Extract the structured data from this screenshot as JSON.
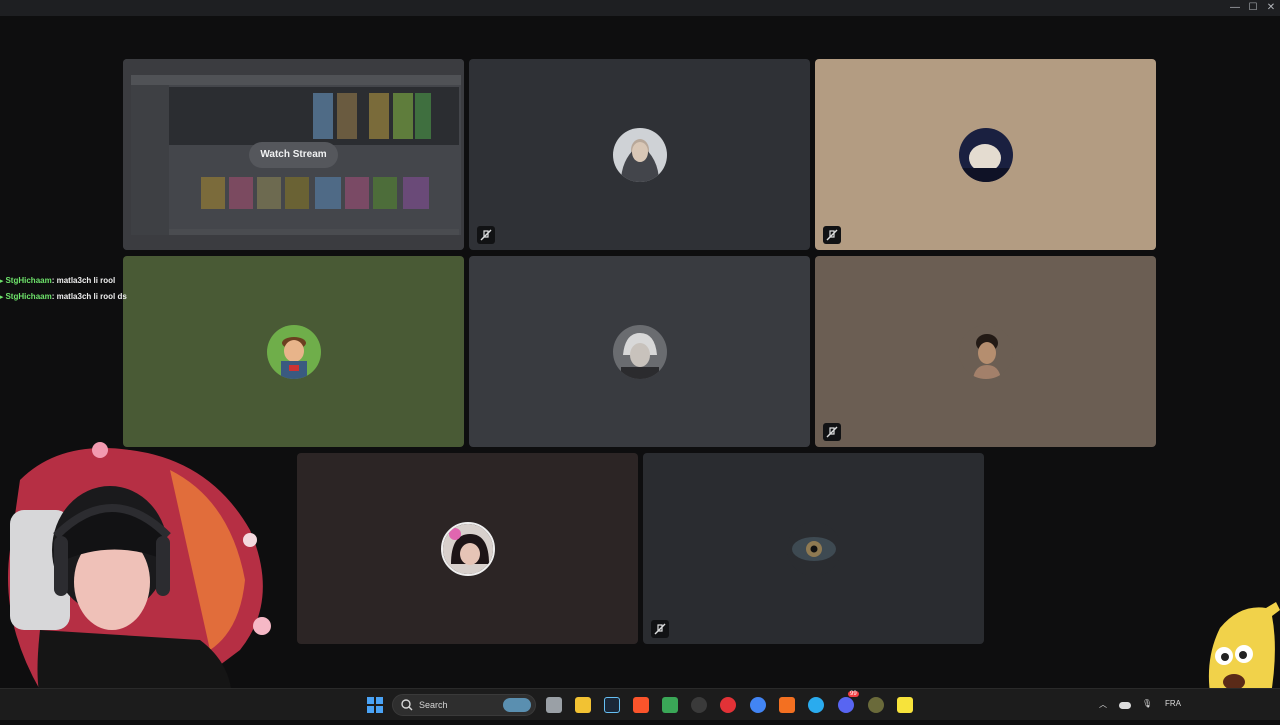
{
  "window": {
    "minimize": "—",
    "maximize": "☐",
    "close": "✕"
  },
  "call": {
    "watch_stream_label": "Watch Stream",
    "tiles": [
      {
        "id": "stream",
        "bg": "#3a3b3e"
      },
      {
        "id": "user-hoodie",
        "bg": "#2f3136",
        "muted": true
      },
      {
        "id": "user-sand",
        "bg": "#b39c82",
        "muted": true
      },
      {
        "id": "user-cartoon",
        "bg": "#495a35",
        "muted": false
      },
      {
        "id": "user-anime",
        "bg": "#393b40",
        "muted": false
      },
      {
        "id": "user-silhouette",
        "bg": "#6b5e53",
        "muted": true
      },
      {
        "id": "user-flower",
        "bg": "#2c2525",
        "muted": false
      },
      {
        "id": "user-eye",
        "bg": "#2a2c30",
        "muted": true
      }
    ]
  },
  "chat": {
    "messages": [
      {
        "user": "StgHichaam",
        "text": ": matla3ch li rool"
      },
      {
        "user": "StgHichaam",
        "text": ": matla3ch li rool ds"
      }
    ]
  },
  "taskbar": {
    "search_label": "Search",
    "language": "FRA",
    "discord_badge": "99",
    "colors": {
      "accent": "#4aa3f5"
    }
  }
}
